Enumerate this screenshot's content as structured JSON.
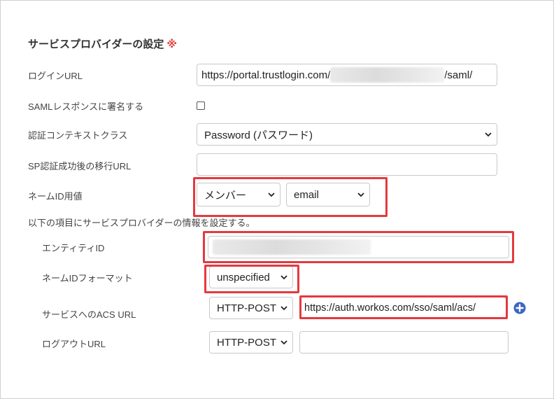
{
  "section": {
    "title": "サービスプロバイダーの設定",
    "required_mark": "※"
  },
  "fields": {
    "login_url": {
      "label": "ログインURL",
      "value_prefix": "https://portal.trustlogin.com/",
      "value_suffix": "/saml/"
    },
    "saml_sign": {
      "label": "SAMLレスポンスに署名する",
      "checked": false
    },
    "auth_context": {
      "label": "認証コンテキストクラス",
      "selected": "Password (パスワード)"
    },
    "sp_redirect_url": {
      "label": "SP認証成功後の移行URL",
      "value": ""
    },
    "name_id_value": {
      "label": "ネームID用値",
      "select1": "メンバー",
      "select2": "email"
    }
  },
  "sp_info": {
    "intro": "以下の項目にサービスプロバイダーの情報を設定する。",
    "entity_id": {
      "label": "エンティティID"
    },
    "name_id_format": {
      "label": "ネームIDフォーマット",
      "selected": "unspecified"
    },
    "acs_url": {
      "label": "サービスへのACS URL",
      "binding": "HTTP-POST",
      "value": "https://auth.workos.com/sso/saml/acs/"
    },
    "logout_url": {
      "label": "ログアウトURL",
      "binding": "HTTP-POST",
      "value": ""
    }
  },
  "colors": {
    "highlight": "#e4393f",
    "plus_icon": "#3b66c4",
    "required": "#e0443e"
  }
}
